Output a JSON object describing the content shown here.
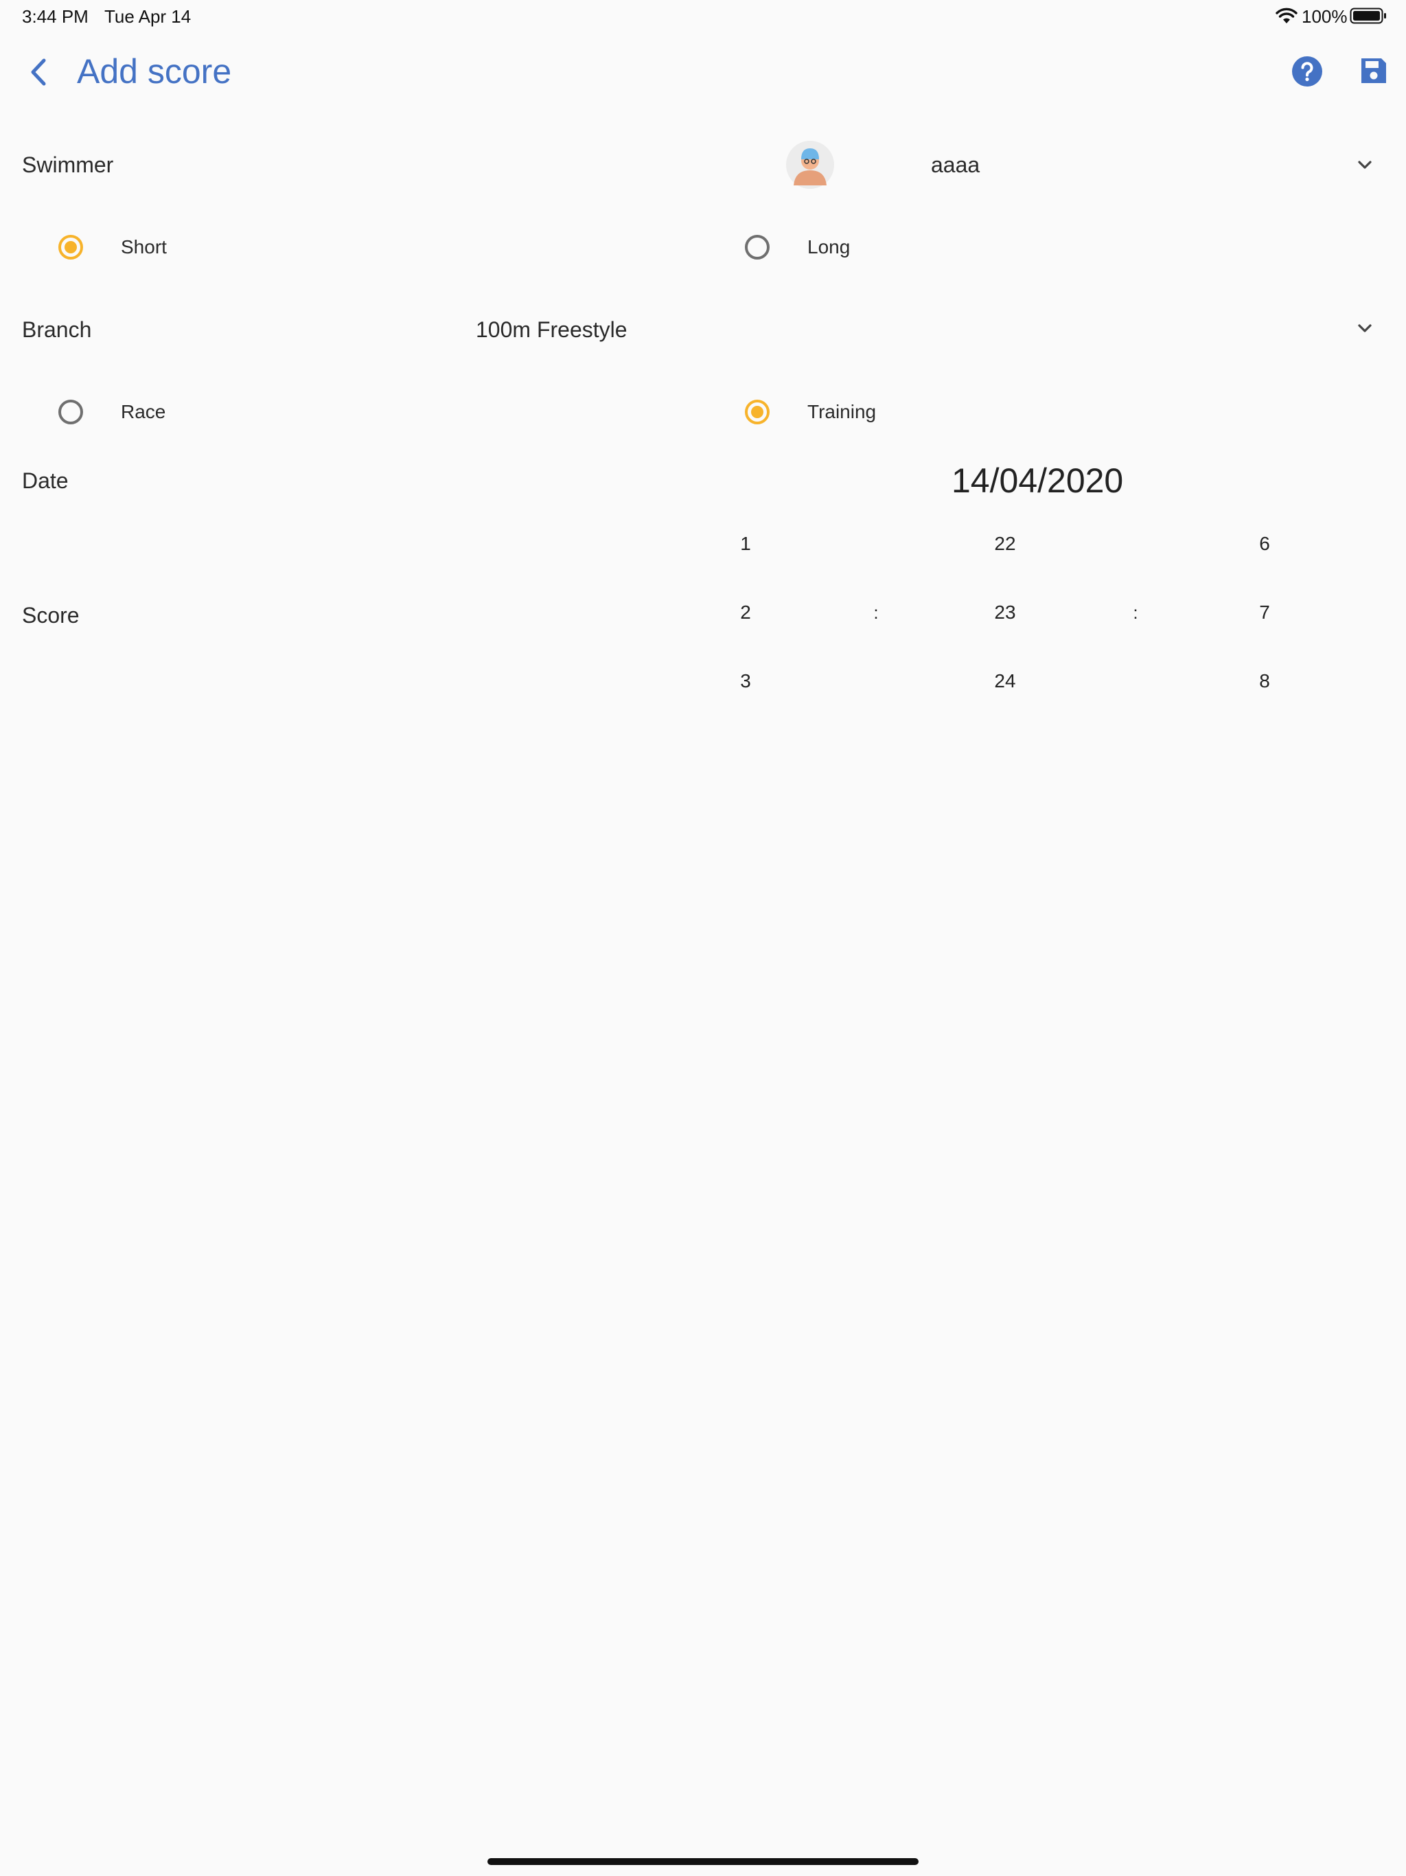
{
  "status_bar": {
    "time": "3:44 PM",
    "date": "Tue Apr 14",
    "battery_percent": "100%",
    "wifi_icon": "wifi-icon",
    "battery_icon": "battery-full-icon"
  },
  "app_bar": {
    "title": "Add score",
    "back_icon": "chevron-left-icon",
    "help_icon": "help-circle-icon",
    "save_icon": "floppy-disk-icon",
    "accent_color": "#4472c4"
  },
  "form": {
    "swimmer": {
      "label": "Swimmer",
      "selected_value": "aaaa",
      "avatar_icon": "swimmer-avatar-icon",
      "dropdown_icon": "chevron-down-icon"
    },
    "pool_length": {
      "options": [
        {
          "label": "Short",
          "checked": true
        },
        {
          "label": "Long",
          "checked": false
        }
      ]
    },
    "branch": {
      "label": "Branch",
      "selected_value": "100m Freestyle",
      "dropdown_icon": "chevron-down-icon"
    },
    "score_type": {
      "options": [
        {
          "label": "Race",
          "checked": false
        },
        {
          "label": "Training",
          "checked": true
        }
      ]
    },
    "date": {
      "label": "Date",
      "value": "14/04/2020"
    },
    "score": {
      "label": "Score",
      "separator": ":",
      "columns": [
        [
          "1",
          "2",
          "3"
        ],
        [
          "22",
          "23",
          "24"
        ],
        [
          "6",
          "7",
          "8"
        ]
      ]
    },
    "radio_selected_color": "#f7b32b"
  }
}
